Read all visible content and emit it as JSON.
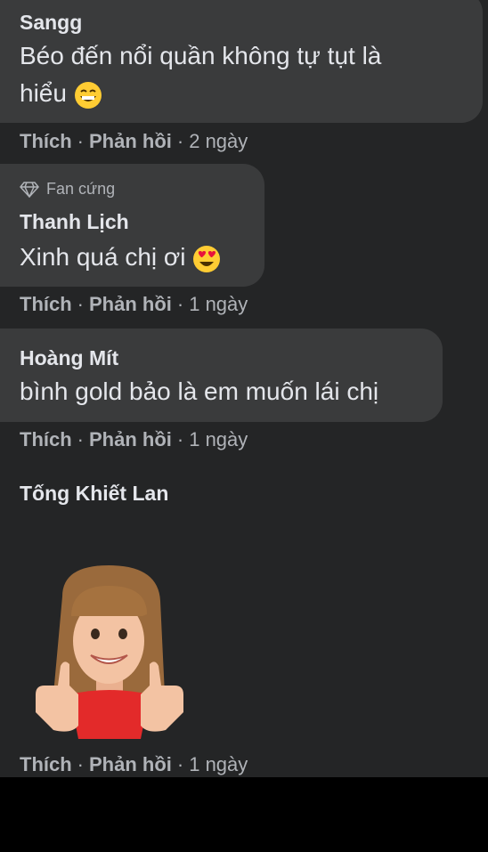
{
  "comments": [
    {
      "author": "Sangg",
      "text_line1": "Béo đến nổi quần không tự tụt là",
      "text_line2": "hiểu",
      "emoji": "grinning-face-icon",
      "like": "Thích",
      "reply": "Phản hồi",
      "time": "2 ngày"
    },
    {
      "badge": "Fan cứng",
      "badge_icon": "diamond-icon",
      "author": "Thanh Lịch",
      "text_line1": "Xinh quá chị ơi",
      "emoji": "heart-eyes-face-icon",
      "like": "Thích",
      "reply": "Phản hồi",
      "time": "1 ngày"
    },
    {
      "author": "Hoàng Mít",
      "text_line1": "bình gold bảo là em muốn lái chị",
      "like": "Thích",
      "reply": "Phản hồi",
      "time": "1 ngày"
    },
    {
      "author": "Tống Khiết Lan",
      "sticker": "avatar-thumbs-up-sticker",
      "like": "Thích",
      "reply": "Phản hồi",
      "time": "1 ngày"
    }
  ],
  "colors": {
    "background": "#242526",
    "bubble": "#3a3b3c",
    "primary_text": "#e4e6eb",
    "secondary_text": "#b0b3b8"
  }
}
